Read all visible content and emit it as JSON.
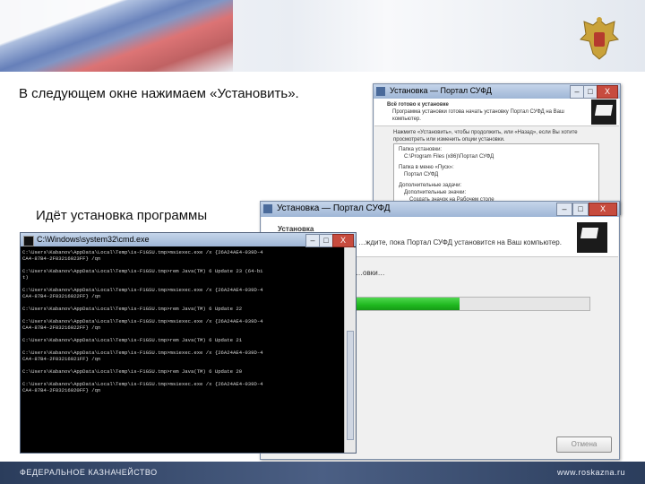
{
  "slide": {
    "caption_install_click": "В следующем окне нажимаем «Установить».",
    "caption_installing": "Идёт установка программы",
    "footer_left": "ФЕДЕРАЛЬНОЕ КАЗНАЧЕЙСТВО",
    "footer_right": "www.roskazna.ru"
  },
  "ready_window": {
    "title": "Установка — Портал СУФД",
    "heading": "Всё готово к установке",
    "subheading": "Программа установки готова начать установку Портал СУФД на Ваш компьютер.",
    "instruction": "Нажмите «Установить», чтобы продолжить, или «Назад», если Вы хотите просмотреть или изменить опции установки.",
    "dest_label": "Папка установки:",
    "dest_value": "C:\\Program Files (x86)\\Портал СУФД",
    "menu_label": "Папка в меню «Пуск»:",
    "menu_value": "Портал СУФД",
    "extra_label": "Дополнительные задачи:",
    "extra_sub": "Дополнительные значки:",
    "extra_value": "Создать значок на Рабочем столе"
  },
  "progress_window": {
    "title": "Установка — Портал СУФД",
    "heading": "Установка",
    "subheading": "…ждите, пока Портал СУФД установится на Ваш компьютер.",
    "status": "…овки…",
    "progress": 0.6,
    "cancel_label": "Отмена"
  },
  "console": {
    "title": "C:\\Windows\\system32\\cmd.exe",
    "lines": [
      "C:\\Users\\Kabanov\\AppData\\Local\\Temp\\is-F1GSU.tmp>msiexec.exe /x {26A24AE4-039D-4",
      "CA4-87B4-2F83216023FF} /qn",
      "",
      "C:\\Users\\Kabanov\\AppData\\Local\\Temp\\is-F1GSU.tmp>rem Java(TM) 6 Update 23 (64-bi",
      "t)",
      "",
      "C:\\Users\\Kabanov\\AppData\\Local\\Temp\\is-F1GSU.tmp>msiexec.exe /x {26A24AE4-039D-4",
      "CA4-87B4-2F83216022FF} /qn",
      "",
      "C:\\Users\\Kabanov\\AppData\\Local\\Temp\\is-F1GSU.tmp>rem Java(TM) 6 Update 22",
      "",
      "C:\\Users\\Kabanov\\AppData\\Local\\Temp\\is-F1GSU.tmp>msiexec.exe /x {26A24AE4-039D-4",
      "CA4-87B4-2F83216022FF} /qn",
      "",
      "C:\\Users\\Kabanov\\AppData\\Local\\Temp\\is-F1GSU.tmp>rem Java(TM) 6 Update 21",
      "",
      "C:\\Users\\Kabanov\\AppData\\Local\\Temp\\is-F1GSU.tmp>msiexec.exe /x {26A24AE4-039D-4",
      "CA4-87B4-2F83216021FF} /qn",
      "",
      "C:\\Users\\Kabanov\\AppData\\Local\\Temp\\is-F1GSU.tmp>rem Java(TM) 6 Update 20",
      "",
      "C:\\Users\\Kabanov\\AppData\\Local\\Temp\\is-F1GSU.tmp>msiexec.exe /x {26A24AE4-039D-4",
      "CA4-87B4-2F83216020FF} /qn"
    ]
  },
  "window_controls": {
    "minimize": "–",
    "maximize": "□",
    "close": "X"
  },
  "colors": {
    "progress": "#1fb81f",
    "console_bg": "#000000"
  }
}
